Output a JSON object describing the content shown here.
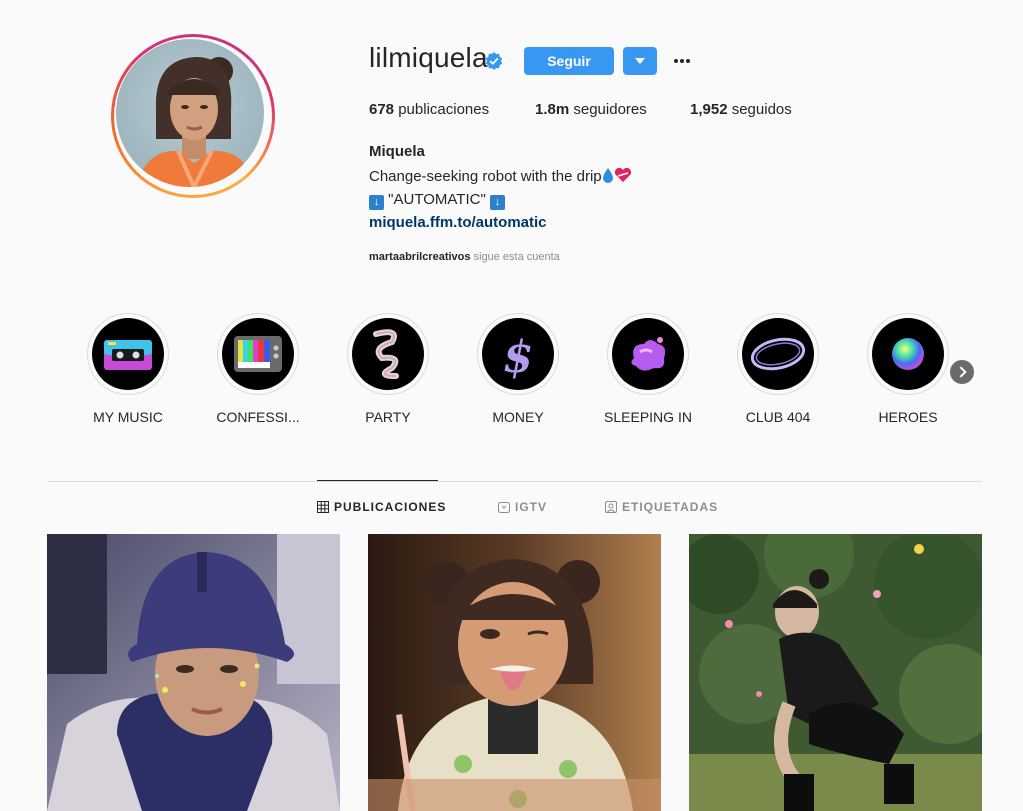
{
  "profile": {
    "username": "lilmiquela",
    "verified": true,
    "follow_label": "Seguir",
    "more_icon": "ellipsis-icon",
    "stats": {
      "posts_count": "678",
      "posts_label": "publicaciones",
      "followers_count": "1.8m",
      "followers_label": "seguidores",
      "following_count": "1,952",
      "following_label": "seguidos"
    },
    "bio": {
      "name": "Miquela",
      "line1": "Change-seeking robot with the drip",
      "line2": "\"AUTOMATIC\"",
      "arrow_symbol": "↓",
      "link": "miquela.ffm.to/automatic"
    },
    "followed_by": {
      "account": "martaabrilcreativos",
      "text": "sigue esta cuenta"
    }
  },
  "highlights": [
    {
      "label": "MY MUSIC",
      "icon": "cassette-icon"
    },
    {
      "label": "CONFESSI...",
      "icon": "tv-icon"
    },
    {
      "label": "PARTY",
      "icon": "ribbon-icon"
    },
    {
      "label": "MONEY",
      "icon": "dollar-icon"
    },
    {
      "label": "SLEEPING IN",
      "icon": "blob-icon"
    },
    {
      "label": "CLUB 404",
      "icon": "ring-icon"
    },
    {
      "label": "HEROES",
      "icon": "orb-icon"
    }
  ],
  "tabs": [
    {
      "label": "PUBLICACIONES",
      "icon": "grid-icon",
      "active": true
    },
    {
      "label": "IGTV",
      "icon": "igtv-icon",
      "active": false
    },
    {
      "label": "ETIQUETADAS",
      "icon": "tagged-icon",
      "active": false
    }
  ],
  "colors": {
    "accent": "#3897f0",
    "link": "#00376b",
    "muted": "#8e8e8e",
    "text": "#262626",
    "background": "#fafafa"
  }
}
